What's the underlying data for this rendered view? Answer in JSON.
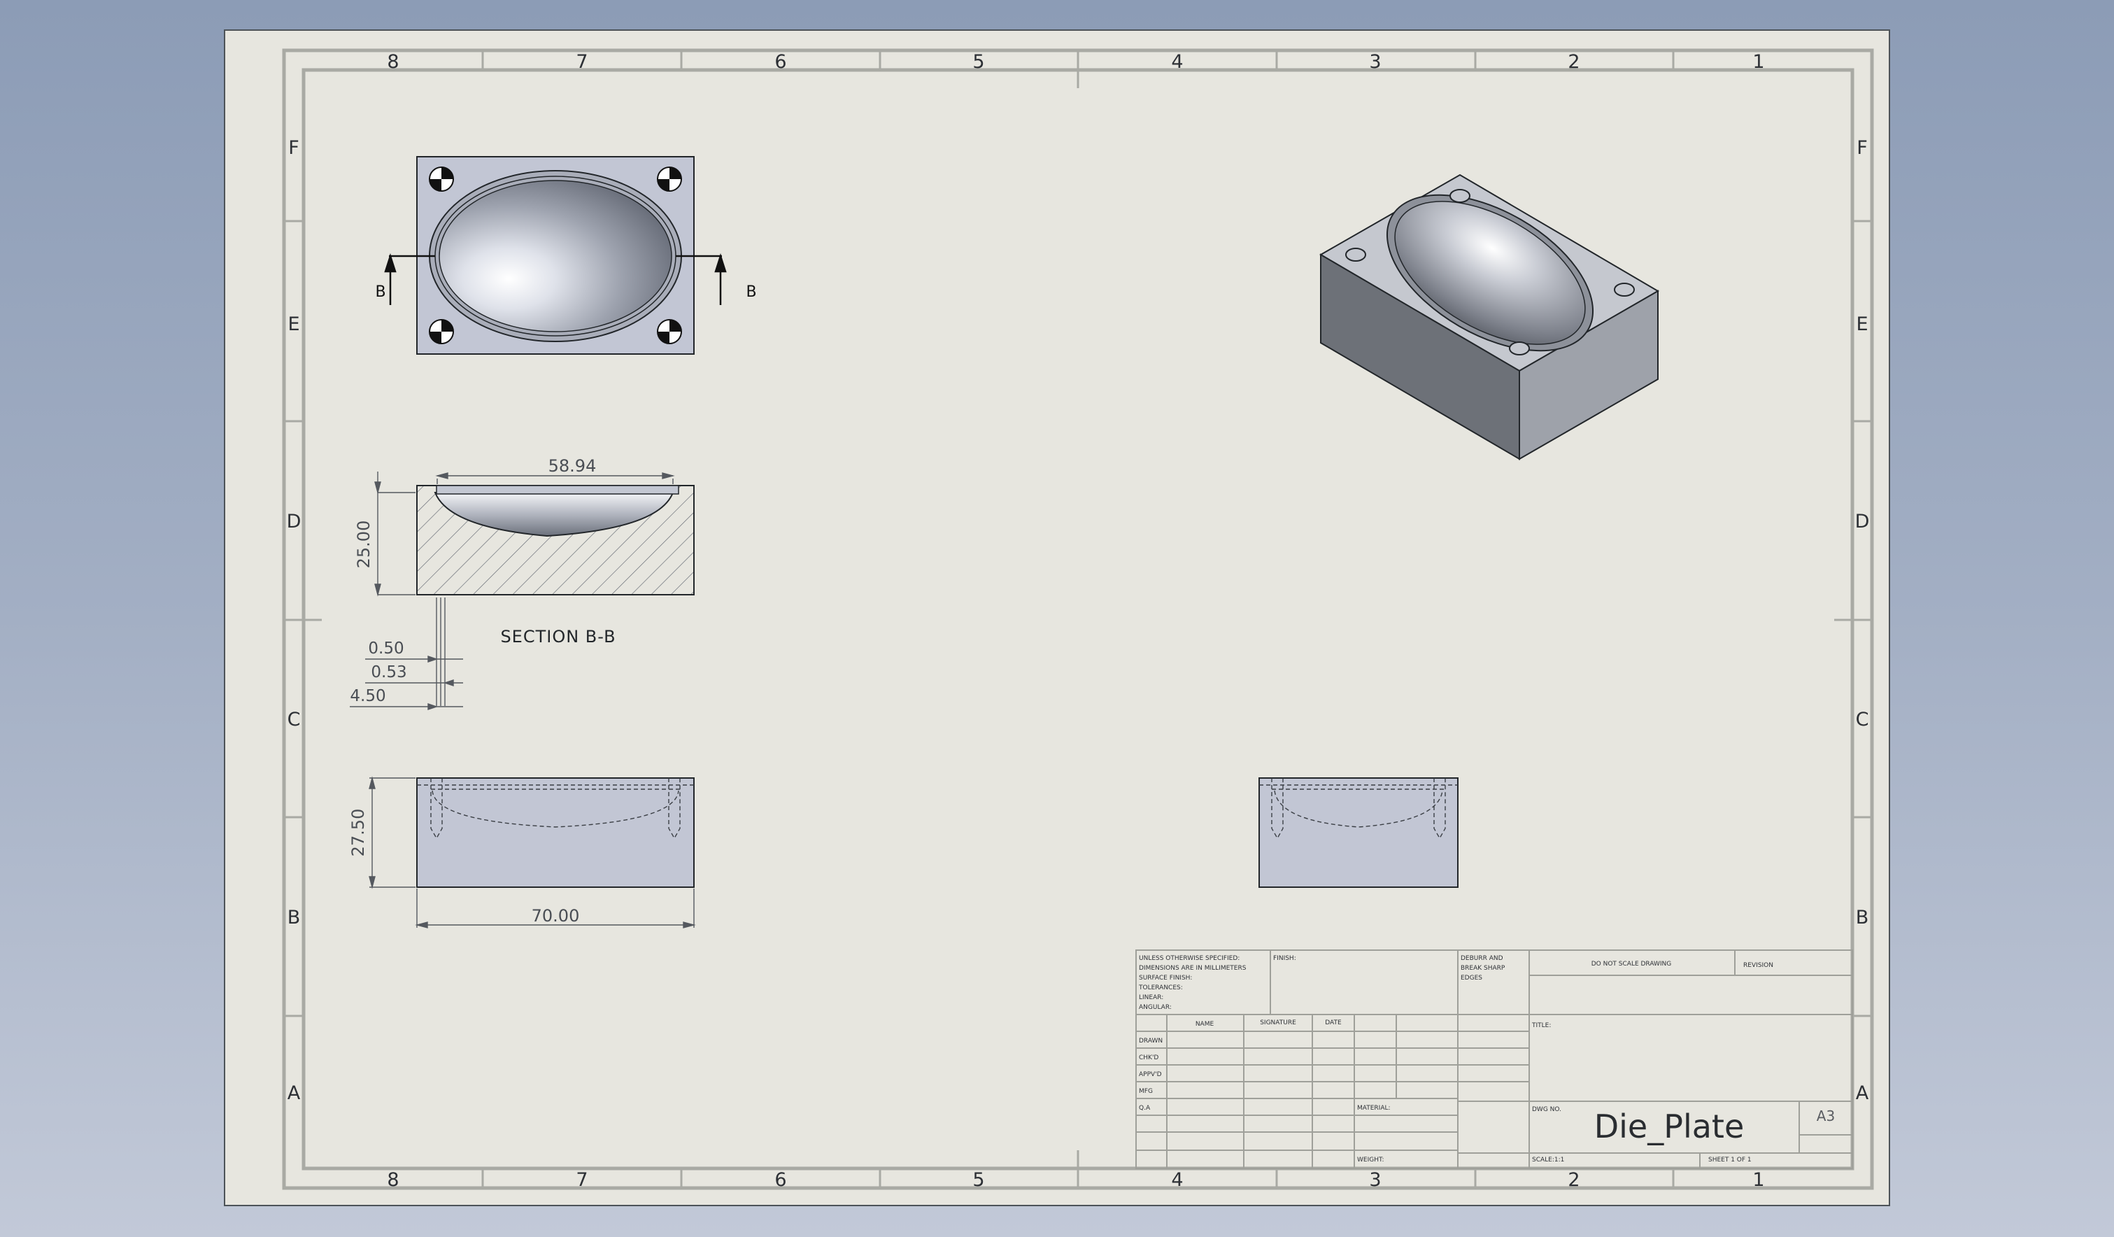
{
  "zones": {
    "columns": [
      "8",
      "7",
      "6",
      "5",
      "4",
      "3",
      "2",
      "1"
    ],
    "rows": [
      "F",
      "E",
      "D",
      "C",
      "B",
      "A"
    ]
  },
  "views": {
    "section_marker": "B",
    "section_title": "SECTION B-B",
    "dimensions": {
      "width_top": "58.94",
      "depth_section": "25.00",
      "offset_a": "0.50",
      "offset_b": "0.53",
      "offset_c": "4.50",
      "height_front": "27.50",
      "length_front": "70.00"
    }
  },
  "title_block": {
    "general_notes": [
      "UNLESS OTHERWISE SPECIFIED:",
      "DIMENSIONS ARE IN MILLIMETERS",
      "SURFACE FINISH:",
      "TOLERANCES:",
      "  LINEAR:",
      "  ANGULAR:"
    ],
    "finish_label": "FINISH:",
    "deburr_lines": [
      "DEBURR AND",
      "BREAK SHARP",
      "EDGES"
    ],
    "no_scale": "DO NOT SCALE DRAWING",
    "revision_label": "REVISION",
    "header_name": "NAME",
    "header_signature": "SIGNATURE",
    "header_date": "DATE",
    "rows": [
      "DRAWN",
      "CHK'D",
      "APPV'D",
      "MFG",
      "Q.A"
    ],
    "title_label": "TITLE:",
    "material_label": "MATERIAL:",
    "dwg_no_label": "DWG NO.",
    "dwg_no": "Die_Plate",
    "sheet_size": "A3",
    "weight_label": "WEIGHT:",
    "scale_label": "SCALE:1:1",
    "sheet_label": "SHEET 1 OF 1"
  },
  "colors": {
    "background": "#9aa8be",
    "sheet": "#e7e6df",
    "part_fill": "#c2c6d4",
    "line": "#22262a"
  }
}
